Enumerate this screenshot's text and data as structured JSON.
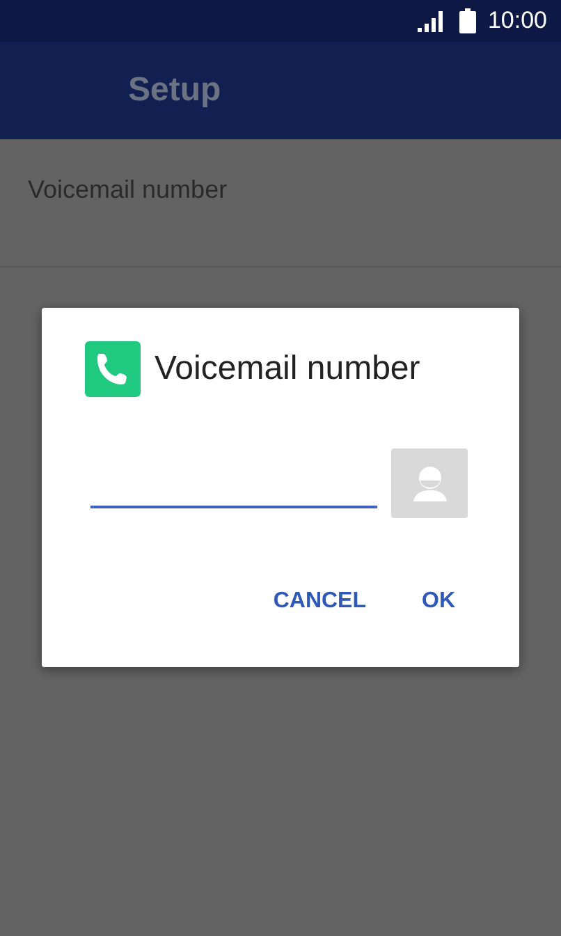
{
  "status_bar": {
    "time": "10:00"
  },
  "app_bar": {
    "title": "Setup"
  },
  "settings": [
    {
      "label": "Voicemail number"
    }
  ],
  "dialog": {
    "title": "Voicemail number",
    "buttons": [
      "CANCEL",
      "OK"
    ]
  }
}
